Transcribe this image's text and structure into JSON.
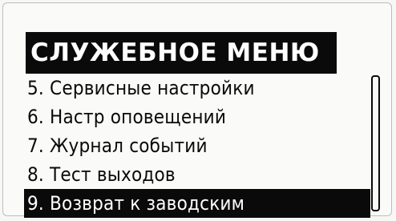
{
  "menu": {
    "title": "СЛУЖЕБНОЕ МЕНЮ",
    "items": [
      {
        "label": "5. Сервисные настройки",
        "selected": false
      },
      {
        "label": "6. Настр оповещений",
        "selected": false
      },
      {
        "label": "7. Журнал событий",
        "selected": false
      },
      {
        "label": "8. Тест выходов",
        "selected": false
      },
      {
        "label": "9. Возврат к заводским",
        "selected": true
      }
    ]
  },
  "colors": {
    "foreground": "#0a0a0a",
    "background": "#fafaf8",
    "highlight_text": "#ffffff"
  }
}
